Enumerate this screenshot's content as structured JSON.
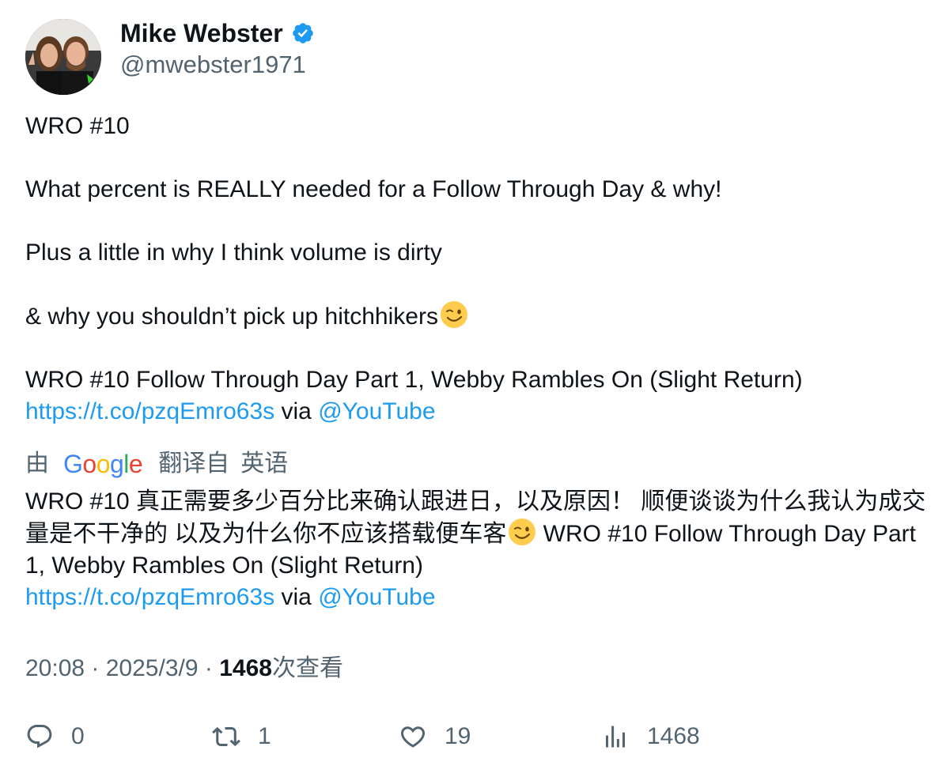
{
  "tweet": {
    "author": {
      "display_name": "Mike Webster",
      "handle": "@mwebster1971",
      "verified_icon": "verified-badge-icon",
      "avatar_icon": "avatar-photo"
    },
    "body": {
      "line1": "WRO #10",
      "line2": "What percent is REALLY needed for a Follow Through Day & why!",
      "line3": "Plus a little in why I think volume is dirty",
      "line4": "& why you shouldn’t pick up hitchhikers",
      "line4_emoji": "winking-face-emoji",
      "line5": "WRO #10 Follow Through Day Part 1, Webby Rambles On (Slight Return)",
      "link": "https://t.co/pzqEmro63s",
      "via": " via ",
      "mention": "@YouTube"
    },
    "translation_bar": {
      "by_label": "由",
      "google_letters": [
        "G",
        "o",
        "o",
        "g",
        "l",
        "e"
      ],
      "translated_from_label": "翻译自",
      "source_language": "英语"
    },
    "translation": {
      "text_part1": "WRO #10 真正需要多少百分比来确认跟进日，以及原因！ 顺便谈谈为什么我认为成交量是不干净的 以及为什么你不应该搭载便车客",
      "emoji": "winking-face-emoji",
      "text_part2": " WRO #10 Follow Through Day Part 1, Webby Rambles On (Slight Return)",
      "link": "https://t.co/pzqEmro63s",
      "via": " via ",
      "mention": "@YouTube"
    },
    "meta": {
      "time": "20:08",
      "separator": " · ",
      "date": "2025/3/9",
      "views_count": "1468",
      "views_label": "次查看"
    },
    "actions": {
      "reply_count": "0",
      "retweet_count": "1",
      "like_count": "19",
      "views_count": "1468"
    }
  },
  "colors": {
    "text_primary": "#0f1419",
    "text_secondary": "#536471",
    "link": "#1d9bf0",
    "verified": "#1d9bf0"
  }
}
